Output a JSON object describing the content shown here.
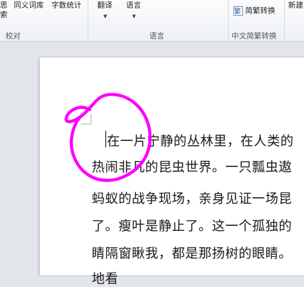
{
  "ribbon": {
    "proofing": {
      "item_partial_line1": "思",
      "item_partial_line2": "索",
      "thesaurus_label": "同义词库",
      "word_count_label": "字数统计",
      "group_label": "校对"
    },
    "language": {
      "translate_label": "翻译",
      "language_label": "语言",
      "group_label": "语言"
    },
    "chinese_conversion": {
      "convert_label": "简繁转换",
      "group_label": "中文简繁转换"
    },
    "next_group_partial": "新建"
  },
  "document": {
    "lines": [
      "在一片宁静的丛林里，在人类的",
      "热闹非凡的昆虫世界。一只瓢虫遨",
      "蚂蚁的战争现场，亲身见证一场昆",
      "了。瘦叶是静止了。这一个孤独的",
      "睛隔窗瞅我，都是那扬树的眼睛。",
      "地看"
    ]
  },
  "colors": {
    "annotation": "#ff00ff",
    "page": "#ffffff",
    "canvas": "#e2e6ea"
  }
}
